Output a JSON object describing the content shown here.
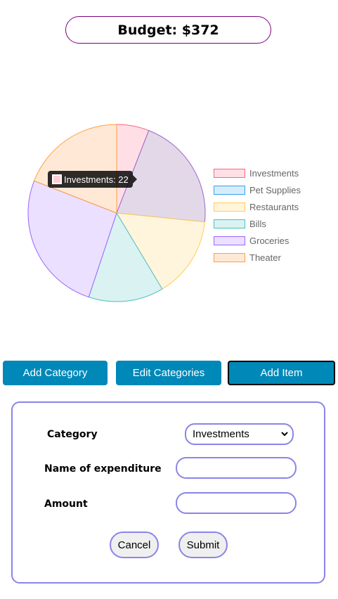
{
  "header": {
    "budget_text": "Budget: $372"
  },
  "tooltip": {
    "text": "Investments: 22",
    "swatch_color": "#ffcdd6"
  },
  "chart_data": {
    "type": "pie",
    "title": "",
    "categories": [
      "Investments",
      "Pet Supplies",
      "Restaurants",
      "Bills",
      "Groceries",
      "Theater"
    ],
    "values": [
      22,
      77,
      55,
      51,
      96,
      71
    ],
    "colors": [
      {
        "fill": "#ffdfe5",
        "stroke": "#ff6384"
      },
      {
        "fill": "#e3d8e8",
        "stroke": "#9966cc"
      },
      {
        "fill": "#fff5dd",
        "stroke": "#ffcd56"
      },
      {
        "fill": "#dbf2f2",
        "stroke": "#4bc0c0"
      },
      {
        "fill": "#ebe0ff",
        "stroke": "#9966ff"
      },
      {
        "fill": "#ffe9d6",
        "stroke": "#ff9f40"
      }
    ],
    "legend_colors": [
      {
        "fill": "#ffe0e6",
        "stroke": "#ff6384"
      },
      {
        "fill": "#d7ecfb",
        "stroke": "#36a2eb"
      },
      {
        "fill": "#fff5dd",
        "stroke": "#ffcd56"
      },
      {
        "fill": "#dbf2f2",
        "stroke": "#4bc0c0"
      },
      {
        "fill": "#ebe0ff",
        "stroke": "#9966ff"
      },
      {
        "fill": "#ffe9d6",
        "stroke": "#ff9f40"
      }
    ],
    "legend_position": "right"
  },
  "buttons": {
    "add_category": "Add Category",
    "edit_categories": "Edit Categories",
    "add_item": "Add Item"
  },
  "form": {
    "category_label": "Category",
    "category_selected": "Investments",
    "name_label": "Name of expenditure",
    "name_value": "",
    "amount_label": "Amount",
    "amount_value": "",
    "cancel_label": "Cancel",
    "submit_label": "Submit"
  },
  "icons": {
    "select_chevron": "chevron-down-icon"
  }
}
